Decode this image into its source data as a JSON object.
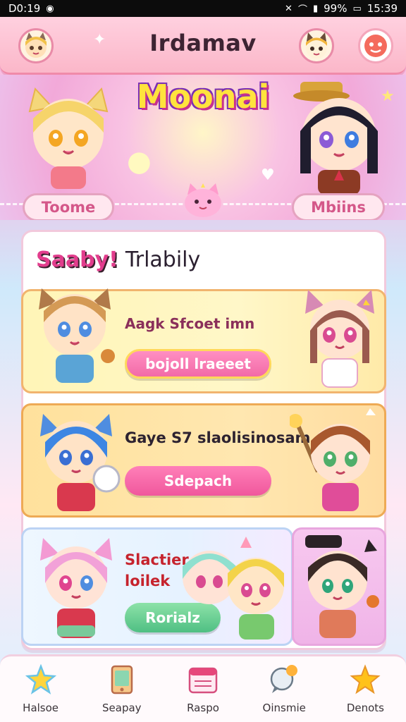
{
  "status_bar": {
    "time_left": "D0:19",
    "battery": "99%",
    "time_right": "15:39"
  },
  "top_bar": {
    "title": "Irdamav",
    "left_avatar_icon": "cat-avatar-icon",
    "right_avatar_icon": "dog-avatar-icon",
    "settings_icon": "profile-settings-icon"
  },
  "hero": {
    "title": "Moonai",
    "tab_left": "Toome",
    "tab_right": "Mbiins"
  },
  "panel": {
    "header_accent": "Saaby!",
    "header_plain": "Trlabily"
  },
  "cards": [
    {
      "title": "Aagk Sfcoet imn",
      "button": "bojoll lraeeet"
    },
    {
      "title": "Gaye S7 slaolisinosam",
      "button": "Sdepach"
    },
    {
      "title": "Slactier loilek",
      "button": "Rorialz"
    }
  ],
  "bottom_nav": [
    {
      "label": "Halsoe",
      "icon": "star-icon"
    },
    {
      "label": "Seapay",
      "icon": "phone-card-icon"
    },
    {
      "label": "Raspo",
      "icon": "calendar-icon"
    },
    {
      "label": "Oinsmie",
      "icon": "chat-bubble-icon"
    },
    {
      "label": "Denots",
      "icon": "star-filled-icon"
    }
  ],
  "colors": {
    "accent_pink": "#f26aa7",
    "hero_title_yellow": "#ffe33d",
    "panel_header_pink": "#e23d8d",
    "green_button": "#4fbf83"
  }
}
